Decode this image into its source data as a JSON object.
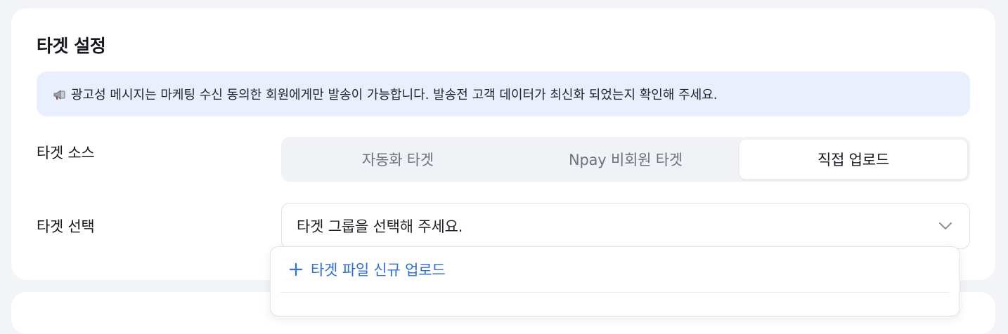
{
  "section": {
    "title": "타겟 설정",
    "notice": "광고성 메시지는 마케팅 수신 동의한 회원에게만 발송이 가능합니다. 발송전 고객 데이터가 최신화 되었는지 확인해 주세요.",
    "notice_icon": "megaphone-icon"
  },
  "target_source": {
    "label": "타겟 소스",
    "options": [
      "자동화 타겟",
      "Npay 비회원 타겟",
      "직접 업로드"
    ],
    "selected": "직접 업로드"
  },
  "target_select": {
    "label": "타겟 선택",
    "placeholder": "타겟 그룹을 선택해 주세요.",
    "dropdown": {
      "upload_new": "타겟 파일 신규 업로드"
    }
  },
  "colors": {
    "accent": "#2e6fe0",
    "notice_bg": "#e9effc",
    "page_bg": "#f3f4f8"
  }
}
